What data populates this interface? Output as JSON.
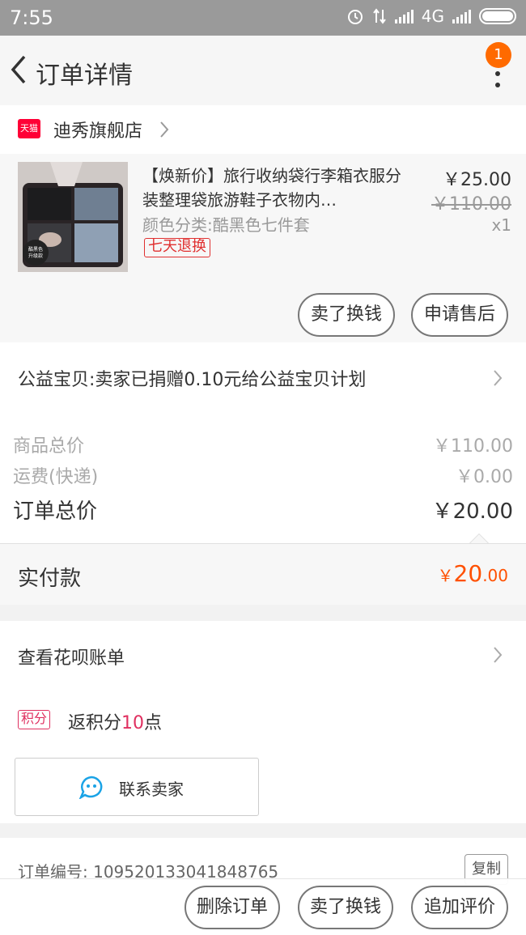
{
  "statusbar": {
    "time": "7:55",
    "network": "4G"
  },
  "navbar": {
    "title": "订单详情",
    "badge": "1"
  },
  "shop": {
    "tag": "天猫",
    "name": "迪秀旗舰店"
  },
  "product": {
    "image_caption": "酷黑色\n升级款",
    "title": "【焕新价】旅行收纳袋行李箱衣服分装整理袋旅游鞋子衣物内…",
    "spec": "颜色分类:酷黑色七件套",
    "tag": "七天退换",
    "price": "￥25.00",
    "original_price": "￥110.00",
    "quantity": "x1",
    "btn_sell": "卖了换钱",
    "btn_aftersale": "申请售后"
  },
  "charity": {
    "text": "公益宝贝:卖家已捐赠0.10元给公益宝贝计划"
  },
  "summary": {
    "goods_label": "商品总价",
    "goods_value": "￥110.00",
    "shipping_label": "运费(快递)",
    "shipping_value": "￥0.00",
    "total_label": "订单总价",
    "total_value": "￥20.00"
  },
  "paid": {
    "label": "实付款",
    "currency": "￥",
    "int": "20",
    "dec": ".00"
  },
  "huabei": {
    "label": "查看花呗账单"
  },
  "points": {
    "tag": "积分",
    "prefix": "返积分",
    "num": "10",
    "suffix": "点"
  },
  "contact": {
    "label": "联系卖家"
  },
  "order": {
    "number": "订单编号: 109520133041848765",
    "copy": "复制"
  },
  "bottom": {
    "delete": "删除订单",
    "sell": "卖了换钱",
    "review": "追加评价"
  },
  "colors": {
    "accent": "#ff5000",
    "tmall": "#ff0036",
    "badge": "#ff6a00"
  }
}
